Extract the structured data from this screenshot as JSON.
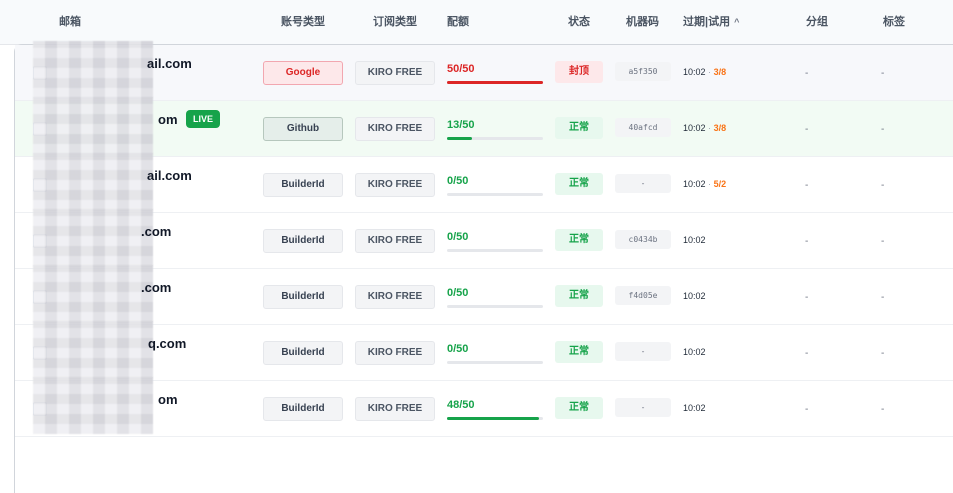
{
  "headers": {
    "email": "邮箱",
    "account_type": "账号类型",
    "sub_type": "订阅类型",
    "quota": "配额",
    "status": "状态",
    "machine": "机器码",
    "expiry": "过期|试用",
    "group": "分组",
    "tags": "标签"
  },
  "rows": [
    {
      "email_suffix": "ail.com",
      "account_type": "Google",
      "sub_type": "KIRO FREE",
      "quota_text": "50/50",
      "quota_fraction": 1.0,
      "quota_color": "#dc2626",
      "status": "封顶",
      "machine": "a5f350",
      "time": "10:02",
      "trial_sep": "·",
      "trial": "3/8",
      "group": "-",
      "tag": "-"
    },
    {
      "email_suffix": "om",
      "live": "LIVE",
      "account_type": "Github",
      "sub_type": "KIRO FREE",
      "quota_text": "13/50",
      "quota_fraction": 0.26,
      "quota_color": "#16a34a",
      "status": "正常",
      "machine": "40afcd",
      "time": "10:02",
      "trial_sep": "·",
      "trial": "3/8",
      "group": "-",
      "tag": "-"
    },
    {
      "email_suffix": "ail.com",
      "account_type": "BuilderId",
      "sub_type": "KIRO FREE",
      "quota_text": "0/50",
      "quota_fraction": 0,
      "quota_color": "#16a34a",
      "status": "正常",
      "machine": "-",
      "time": "10:02",
      "trial_sep": "·",
      "trial": "5/2",
      "group": "-",
      "tag": "-"
    },
    {
      "email_suffix": ".com",
      "account_type": "BuilderId",
      "sub_type": "KIRO FREE",
      "quota_text": "0/50",
      "quota_fraction": 0,
      "quota_color": "#16a34a",
      "status": "正常",
      "machine": "c0434b",
      "time": "10:02",
      "group": "-",
      "tag": "-"
    },
    {
      "email_suffix": ".com",
      "account_type": "BuilderId",
      "sub_type": "KIRO FREE",
      "quota_text": "0/50",
      "quota_fraction": 0,
      "quota_color": "#16a34a",
      "status": "正常",
      "machine": "f4d05e",
      "time": "10:02",
      "group": "-",
      "tag": "-"
    },
    {
      "email_suffix": "q.com",
      "account_type": "BuilderId",
      "sub_type": "KIRO FREE",
      "quota_text": "0/50",
      "quota_fraction": 0,
      "quota_color": "#16a34a",
      "status": "正常",
      "machine": "-",
      "time": "10:02",
      "group": "-",
      "tag": "-"
    },
    {
      "email_suffix": "om",
      "account_type": "BuilderId",
      "sub_type": "KIRO FREE",
      "quota_text": "48/50",
      "quota_fraction": 0.96,
      "quota_color": "#16a34a",
      "status": "正常",
      "machine": "-",
      "time": "10:02",
      "group": "-",
      "tag": "-"
    }
  ],
  "colors": {
    "ok": "#16a34a",
    "danger": "#dc2626",
    "trial": "#f97316"
  }
}
